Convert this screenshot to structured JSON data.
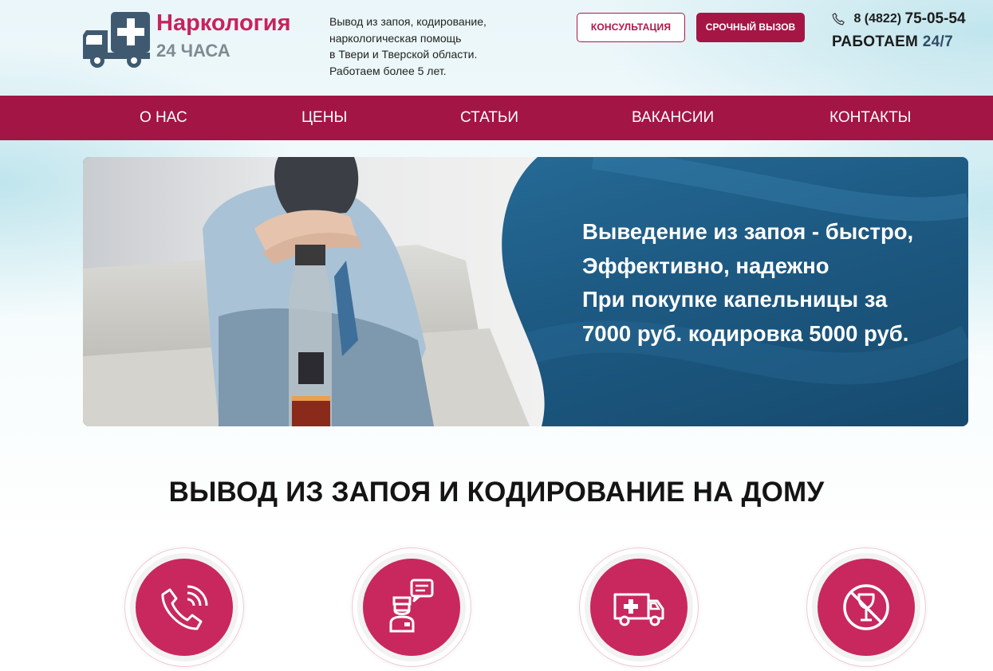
{
  "colors": {
    "brand": "#a31545",
    "brand_pink": "#c7235d",
    "banner_blue": "#1e5f86",
    "logo_grey": "#3f5a70"
  },
  "header": {
    "logo": {
      "title": "Наркология",
      "subtitle": "24 ЧАСА",
      "icon": "ambulance-cross-icon"
    },
    "tagline": [
      "Вывод из запоя, кодирование,",
      "наркологическая помощь",
      "в Твери и Тверской области.",
      "Работаем более 5 лет."
    ],
    "buttons": {
      "consult": "КОНСУЛЬТАЦИЯ",
      "urgent": "СРОЧНЫЙ ВЫЗОВ"
    },
    "phone": {
      "code": "8 (4822)",
      "number": "75-05-54",
      "icon": "phone-icon"
    },
    "hours": {
      "label": "РАБОТАЕМ",
      "value": "24/7"
    }
  },
  "nav": {
    "items": [
      {
        "label": "О НАС"
      },
      {
        "label": "ЦЕНЫ"
      },
      {
        "label": "СТАТЬИ"
      },
      {
        "label": "ВАКАНСИИ"
      },
      {
        "label": "КОНТАКТЫ"
      }
    ]
  },
  "banner": {
    "lines": [
      "Выведение из запоя - быстро,",
      "Эффективно, надежно",
      "При покупке капельницы за",
      "7000 руб. кодировка 5000 руб."
    ]
  },
  "section": {
    "title": "ВЫВОД ИЗ ЗАПОЯ И КОДИРОВАНИЕ НА ДОМУ",
    "features": [
      {
        "icon": "phone-call-icon"
      },
      {
        "icon": "doctor-chat-icon"
      },
      {
        "icon": "ambulance-icon"
      },
      {
        "icon": "no-alcohol-icon"
      }
    ]
  }
}
